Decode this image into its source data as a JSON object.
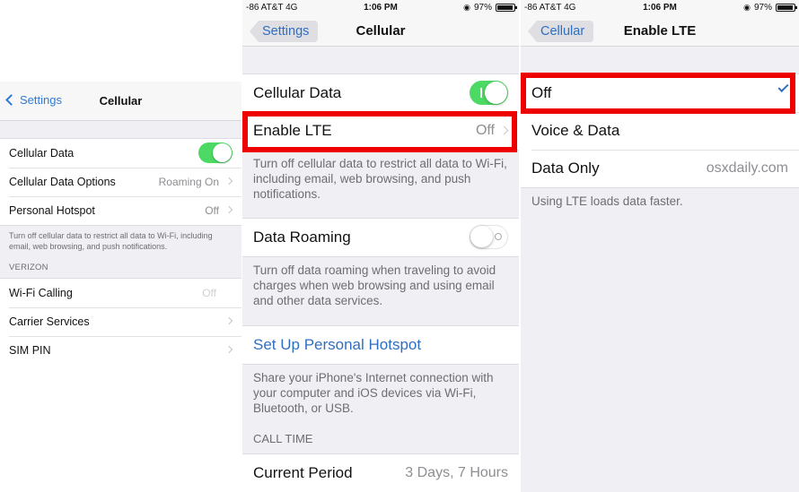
{
  "left_screen": {
    "nav": {
      "back_label": "Settings",
      "title": "Cellular"
    },
    "rows": [
      {
        "label": "Cellular Data",
        "value": "",
        "toggle": "on"
      },
      {
        "label": "Cellular Data Options",
        "value": "Roaming On"
      },
      {
        "label": "Personal Hotspot",
        "value": "Off"
      }
    ],
    "footer": "Turn off cellular data to restrict all data to Wi-Fi, including email, web browsing, and push notifications.",
    "section": "VERIZON",
    "rows2": [
      {
        "label": "Wi-Fi Calling",
        "value": "Off"
      },
      {
        "label": "Carrier Services",
        "value": ""
      },
      {
        "label": "SIM PIN",
        "value": ""
      }
    ]
  },
  "middle_screen": {
    "status": {
      "carrier": "-86 AT&T  4G",
      "time": "1:06 PM",
      "battery": "97%"
    },
    "nav": {
      "back_label": "Settings",
      "title": "Cellular"
    },
    "cellular_data_label": "Cellular Data",
    "cellular_data_toggle": "on",
    "enable_lte_label": "Enable LTE",
    "enable_lte_value": "Off",
    "footer1": "Turn off cellular data to restrict all data to Wi-Fi, including email, web browsing, and push notifications.",
    "data_roaming_label": "Data Roaming",
    "data_roaming_toggle": "off",
    "footer2": "Turn off data roaming when traveling to avoid charges when web browsing and using email and other data services.",
    "hotspot_link": "Set Up Personal Hotspot",
    "footer3": "Share your iPhone's Internet connection with your computer and iOS devices via Wi-Fi, Bluetooth, or USB.",
    "call_time_section": "CALL TIME",
    "current_period_label": "Current Period",
    "current_period_value": "3 Days, 7 Hours"
  },
  "right_screen": {
    "status": {
      "carrier": "-86 AT&T  4G",
      "time": "1:06 PM",
      "battery": "97%"
    },
    "nav": {
      "back_label": "Cellular",
      "title": "Enable LTE"
    },
    "options": [
      {
        "label": "Off",
        "selected": true
      },
      {
        "label": "Voice & Data",
        "selected": false
      },
      {
        "label": "Data Only",
        "selected": false
      }
    ],
    "watermark": "osxdaily.com",
    "footer": "Using LTE loads data faster."
  },
  "colors": {
    "accent": "#2f6fc1",
    "toggle_on": "#4cd964",
    "highlight": "#ee0000"
  }
}
